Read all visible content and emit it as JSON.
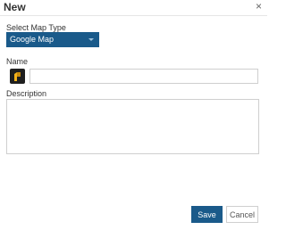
{
  "dialog": {
    "title": "New",
    "close_symbol": "×"
  },
  "map_type": {
    "label": "Select Map Type",
    "selected": "Google Map",
    "icon": "caret-down-icon"
  },
  "name": {
    "label": "Name",
    "value": "",
    "marker_icon": "map-marker-icon"
  },
  "description": {
    "label": "Description",
    "value": ""
  },
  "footer": {
    "save_label": "Save",
    "cancel_label": "Cancel"
  },
  "colors": {
    "accent": "#1a5a8a",
    "marker": "#f2b21b"
  }
}
